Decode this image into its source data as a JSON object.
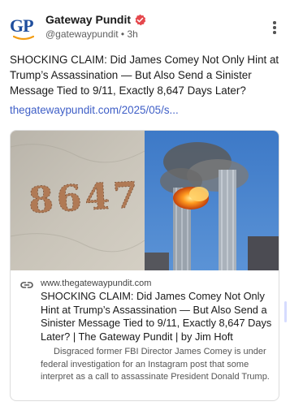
{
  "post": {
    "author": "Gateway Pundit",
    "handle": "@gatewaypundit",
    "separator": "•",
    "time": "3h",
    "logo_text": "GP",
    "text": "SHOCKING CLAIM: Did James Comey Not Only Hint at Trump’s Assassination — But Also Send a Sinister Message Tied to 9/11, Exactly 8,647 Days Later?",
    "link": "thegatewaypundit.com/2025/05/s..."
  },
  "card": {
    "domain": "www.thegatewaypundit.com",
    "title": "SHOCKING CLAIM: Did James Comey Not Only Hint at Trump’s Assassination — But Also Send a Sinister Message Tied to 9/11, Exactly 8,647 Days Later? | The Gateway Pundit | by Jim Hoft",
    "description": "Disgraced former FBI Director James Comey is under federal investigation for an Instagram post that some interpret as a call to assassinate President Donald Trump.",
    "shells_text": "8647"
  },
  "icons": {
    "verified": "verified-badge-icon",
    "menu": "more-vertical-icon",
    "link": "link-icon"
  },
  "colors": {
    "brand_blue": "#1f4e9e",
    "brand_orange": "#f39c12",
    "link_blue": "#3f5fc7",
    "verified_red": "#e5484d"
  }
}
